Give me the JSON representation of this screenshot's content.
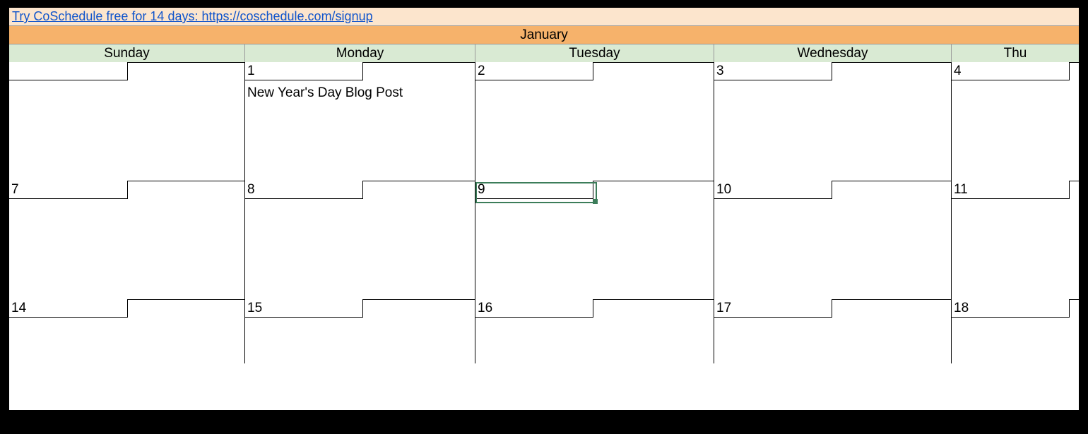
{
  "promo": {
    "text": "Try CoSchedule free for 14 days: https://coschedule.com/signup"
  },
  "month": {
    "name": "January"
  },
  "days": {
    "sun": "Sunday",
    "mon": "Monday",
    "tue": "Tuesday",
    "wed": "Wednesday",
    "thu": "Thu"
  },
  "week1": {
    "sun": "",
    "mon": "1",
    "tue": "2",
    "wed": "3",
    "thu": "4",
    "mon_event": "New Year's Day Blog Post"
  },
  "week2": {
    "sun": "7",
    "mon": "8",
    "tue": "9",
    "wed": "10",
    "thu": "11"
  },
  "week3": {
    "sun": "14",
    "mon": "15",
    "tue": "16",
    "wed": "17",
    "thu": "18"
  }
}
